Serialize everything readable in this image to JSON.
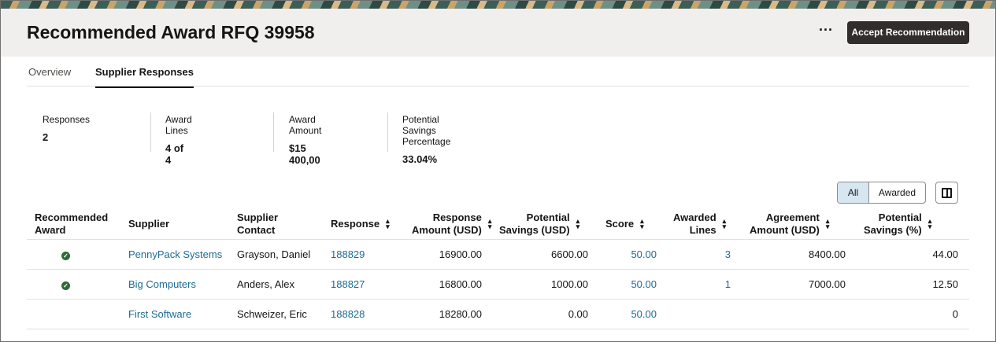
{
  "header": {
    "title": "Recommended Award RFQ 39958",
    "more_icon": "more-horizontal-icon",
    "more_label": "···",
    "accept_label": "Accept Recommendation"
  },
  "tabs": [
    {
      "label": "Overview",
      "active": false
    },
    {
      "label": "Supplier Responses",
      "active": true
    }
  ],
  "metrics": [
    {
      "label": "Responses",
      "value": "2"
    },
    {
      "label": "Award Lines",
      "value": "4 of 4"
    },
    {
      "label": "Award Amount",
      "value": "$15 400,00"
    },
    {
      "label": "Potential Savings Percentage",
      "value": "33.04%"
    }
  ],
  "filter": {
    "all_label": "All",
    "awarded_label": "Awarded",
    "selected": "All",
    "columns_icon": "columns-icon"
  },
  "table": {
    "headers": {
      "recommended_award_1": "Recommended",
      "recommended_award_2": "Award",
      "supplier": "Supplier",
      "supplier_contact_1": "Supplier",
      "supplier_contact_2": "Contact",
      "response": "Response",
      "response_amount_1": "Response",
      "response_amount_2": "Amount (USD)",
      "potential_savings_1": "Potential",
      "potential_savings_2": "Savings (USD)",
      "score": "Score",
      "awarded_lines_1": "Awarded",
      "awarded_lines_2": "Lines",
      "agreement_amount_1": "Agreement",
      "agreement_amount_2": "Amount (USD)",
      "potential_savings_pct_1": "Potential",
      "potential_savings_pct_2": "Savings (%)"
    },
    "rows": [
      {
        "recommended": true,
        "check": "✓",
        "supplier": "PennyPack Systems",
        "contact": "Grayson, Daniel",
        "response": "188829",
        "response_amount": "16900.00",
        "potential_savings": "6600.00",
        "score": "50.00",
        "awarded_lines": "3",
        "agreement_amount": "8400.00",
        "savings_pct": "44.00"
      },
      {
        "recommended": true,
        "check": "✓",
        "supplier": "Big Computers",
        "contact": "Anders, Alex",
        "response": "188827",
        "response_amount": "16800.00",
        "potential_savings": "1000.00",
        "score": "50.00",
        "awarded_lines": "1",
        "agreement_amount": "7000.00",
        "savings_pct": "12.50"
      },
      {
        "recommended": false,
        "check": "",
        "supplier": "First Software",
        "contact": "Schweizer, Eric",
        "response": "188828",
        "response_amount": "18280.00",
        "potential_savings": "0.00",
        "score": "50.00",
        "awarded_lines": "",
        "agreement_amount": "",
        "savings_pct": "0"
      }
    ]
  },
  "colors": {
    "accent_link": "#1e6b92",
    "primary_button": "#312d2a",
    "check_green": "#2e6b35",
    "selected_filter": "#d7e7f2"
  }
}
